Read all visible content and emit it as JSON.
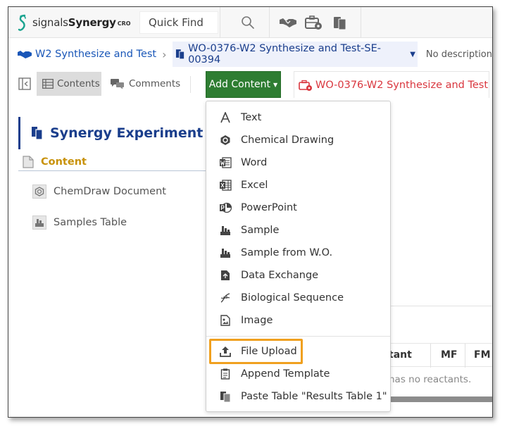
{
  "app": {
    "brand_light": "signals",
    "brand_bold": "Synergy",
    "brand_suffix": "CRO",
    "quick_find": "Quick Find"
  },
  "breadcrumb": {
    "parent": "W2 Synthesize and Test",
    "current": "WO-0376-W2 Synthesize and Test-SE-00394",
    "description": "No description"
  },
  "toolbar": {
    "contents": "Contents",
    "comments": "Comments",
    "add_content": "Add Content",
    "wo_tab": "WO-0376-W2 Synthesize and Test"
  },
  "left_panel": {
    "title": "Synergy Experiment Co",
    "section": "Content",
    "items": [
      "ChemDraw Document",
      "Samples Table"
    ]
  },
  "menu": {
    "items": [
      {
        "label": "Text",
        "icon": "text-icon"
      },
      {
        "label": "Chemical Drawing",
        "icon": "chemical-drawing-icon"
      },
      {
        "label": "Word",
        "icon": "word-icon"
      },
      {
        "label": "Excel",
        "icon": "excel-icon"
      },
      {
        "label": "PowerPoint",
        "icon": "powerpoint-icon"
      },
      {
        "label": "Sample",
        "icon": "sample-icon"
      },
      {
        "label": "Sample from W.O.",
        "icon": "sample-wo-icon"
      },
      {
        "label": "Data Exchange",
        "icon": "data-exchange-icon"
      },
      {
        "label": "Biological Sequence",
        "icon": "biological-sequence-icon"
      },
      {
        "label": "Image",
        "icon": "image-icon"
      },
      {
        "label": "File Upload",
        "icon": "file-upload-icon"
      },
      {
        "label": "Append Template",
        "icon": "append-template-icon"
      },
      {
        "label": "Paste Table \"Results Table 1\"",
        "icon": "paste-table-icon"
      }
    ]
  },
  "background_table": {
    "col_reactant": "tant",
    "col_mf": "MF",
    "col_fm": "FM",
    "empty_text": "has no reactants."
  },
  "colors": {
    "brand_blue": "#1a3e8c",
    "link_blue": "#1a57b8",
    "add_content_green": "#2e7d32",
    "tab_red": "#d9363e",
    "section_gold": "#c8920a",
    "highlight_orange": "#f0a01f"
  }
}
